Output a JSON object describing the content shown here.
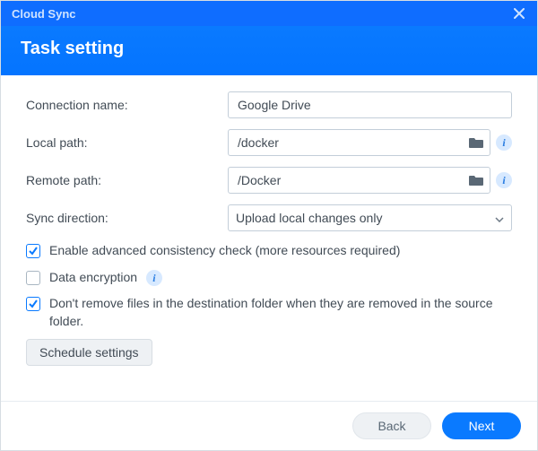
{
  "window": {
    "title": "Cloud Sync"
  },
  "header": {
    "title": "Task setting"
  },
  "form": {
    "connection_name": {
      "label": "Connection name:",
      "value": "Google Drive"
    },
    "local_path": {
      "label": "Local path:",
      "value": "/docker"
    },
    "remote_path": {
      "label": "Remote path:",
      "value": "/Docker"
    },
    "sync_direction": {
      "label": "Sync direction:",
      "value": "Upload local changes only"
    },
    "advanced_check": {
      "checked": true,
      "label": "Enable advanced consistency check (more resources required)"
    },
    "encryption": {
      "checked": false,
      "label": "Data encryption"
    },
    "noremove": {
      "checked": true,
      "label": "Don't remove files in the destination folder when they are removed in the source folder."
    },
    "schedule_btn": "Schedule settings"
  },
  "footer": {
    "back": "Back",
    "next": "Next"
  }
}
